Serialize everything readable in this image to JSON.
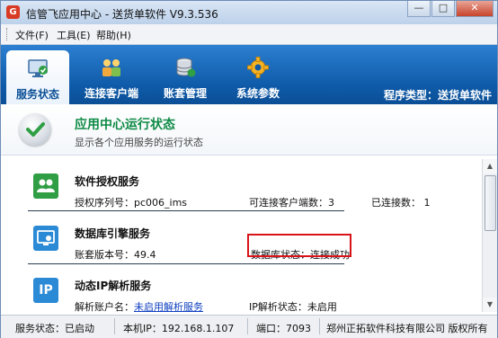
{
  "window": {
    "logo_text": "G",
    "title": "信管飞应用中心 - 送货单软件 V9.3.536",
    "btn_min": "—",
    "btn_max": "□",
    "btn_close": "✕"
  },
  "menu": [
    "文件(F)",
    "工具(E)",
    "帮助(H)"
  ],
  "tabs": [
    {
      "label": "服务状态",
      "icon": "monitor-check-icon",
      "active": true
    },
    {
      "label": "连接客户端",
      "icon": "users-icon",
      "active": false
    },
    {
      "label": "账套管理",
      "icon": "database-icon",
      "active": false
    },
    {
      "label": "系统参数",
      "icon": "gear-icon",
      "active": false
    }
  ],
  "program_type": "程序类型：送货单软件",
  "banner": {
    "title": "应用中心运行状态",
    "subtitle": "显示各个应用服务的运行状态"
  },
  "services": [
    {
      "title": "软件授权服务",
      "icon": "group-users-icon",
      "serial_label": "授权序列号：pc006_ims",
      "max_clients": "可连接客户端数：3",
      "connected": "已连接数：  1"
    },
    {
      "title": "数据库引擎服务",
      "icon": "database-engine-icon",
      "version": "账套版本号：49.4",
      "db_status": "数据库状态：连接成功"
    },
    {
      "title": "动态IP解析服务",
      "icon": "ip-icon",
      "icon_text": "IP",
      "account_label": "解析账户名：",
      "account_link": "未启用解析服务",
      "ip_status": "IP解析状态：未启用"
    }
  ],
  "statusbar": {
    "service": "服务状态：已启动",
    "local_ip": "本机IP：192.168.1.107",
    "port": "端口：7093",
    "copyright": "郑州正拓软件科技有限公司 版权所有"
  },
  "colors": {
    "header_blue": "#0e5aa8",
    "banner_green": "#0e8a45",
    "highlight_red": "#d8141a",
    "link_blue": "#1040c0"
  }
}
